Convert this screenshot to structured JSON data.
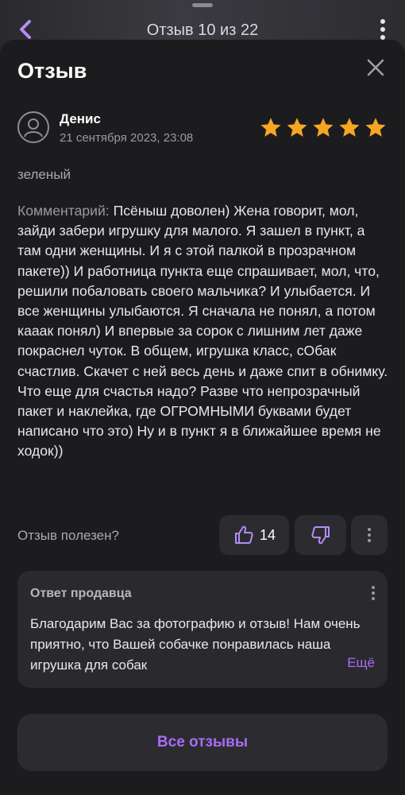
{
  "background_header": {
    "title": "Отзыв 10 из 22"
  },
  "sheet": {
    "title": "Отзыв"
  },
  "review": {
    "author": "Денис",
    "date": "21 сентября 2023, 23:08",
    "rating": 5,
    "rating_max": 5,
    "variant": "зеленый",
    "comment_label": "Комментарий:",
    "comment_text": "Псёныш доволен) Жена говорит, мол, зайди забери игрушку для малого. Я зашел в пункт, а там одни женщины. И я с этой палкой в прозрачном пакете)) И работница пункта еще спрашивает, мол, что, решили побаловать своего мальчика? И улыбается. И все женщины улыбаются. Я сначала не понял, а потом кааак понял) И впервые за сорок с лишним лет даже покраснел чуток. В общем, игрушка класс, сОбак счастлив. Скачет с ней весь день и даже спит в обнимку. Что еще для счастья надо? Разве что непрозрачный пакет и наклейка, где ОГРОМНЫМИ буквами будет написано что это) Ну и в пункт я в ближайшее время не ходок))"
  },
  "helpful": {
    "question": "Отзыв полезен?",
    "like_count": "14"
  },
  "seller_reply": {
    "title": "Ответ продавца",
    "text": "Благодарим Вас за фотографию и отзыв! Нам очень приятно, что Вашей собачке понравилась наша игрушка для собак",
    "more_label": "Ещё"
  },
  "footer": {
    "all_reviews_label": "Все отзывы"
  },
  "colors": {
    "accent": "#a76cf7",
    "star": "#f5a623",
    "sheet_bg": "#1c1c1e",
    "card_bg": "#2a2a2e"
  },
  "icons": {
    "back": "chevron-left-icon",
    "menu": "vertical-dots-icon",
    "close": "close-icon",
    "avatar": "user-avatar-icon",
    "star": "star-icon",
    "like": "thumbs-up-icon",
    "dislike": "thumbs-down-icon"
  }
}
